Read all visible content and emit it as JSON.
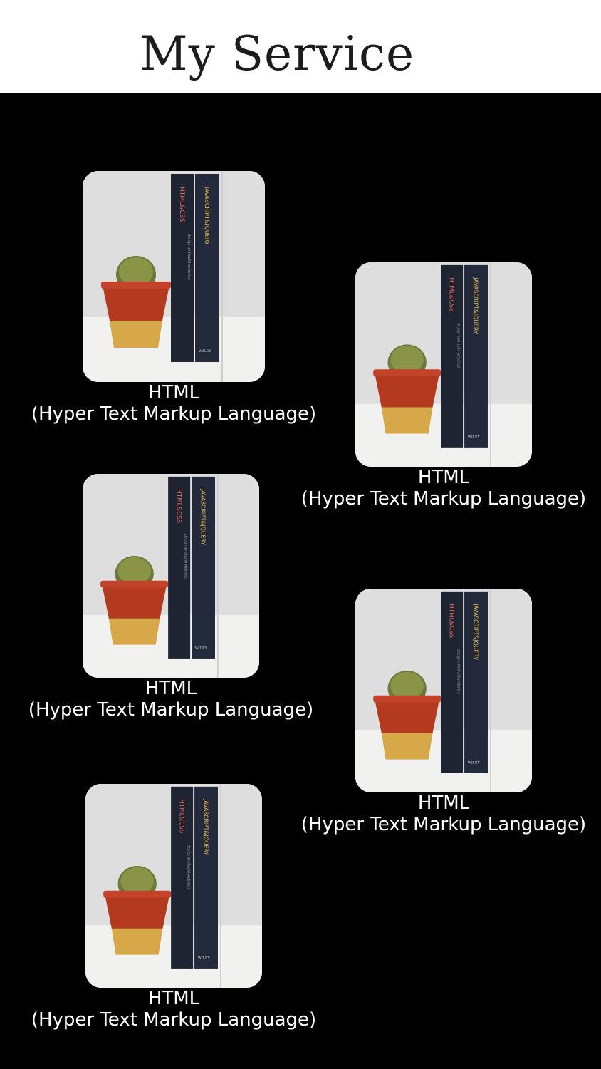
{
  "header": {
    "title": "My Service"
  },
  "photo": {
    "book1_title": "HTML&CSS",
    "book1_subtitle": "design and build websites",
    "book2_title": "JAVASCRIPT&JQUERY",
    "publisher": "WILEY"
  },
  "services": [
    {
      "title": "HTML",
      "subtitle": "(Hyper Text Markup Language)"
    },
    {
      "title": "HTML",
      "subtitle": "(Hyper Text Markup Language)"
    },
    {
      "title": "HTML",
      "subtitle": "(Hyper Text Markup Language)"
    },
    {
      "title": "HTML",
      "subtitle": "(Hyper Text Markup Language)"
    },
    {
      "title": "HTML",
      "subtitle": "(Hyper Text Markup Language)"
    }
  ]
}
